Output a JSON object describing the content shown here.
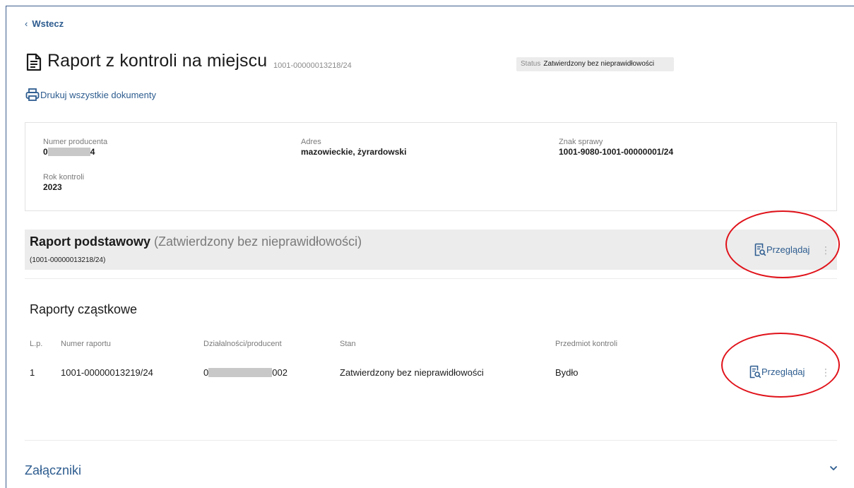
{
  "nav": {
    "back_label": "Wstecz"
  },
  "header": {
    "title": "Raport z kontroli na miejscu",
    "number": "1001-00000013218/24",
    "status_label": "Status",
    "status_value": "Zatwierdzony bez nieprawidłowości",
    "print_label": "Drukuj wszystkie dokumenty"
  },
  "info": {
    "producer_label": "Numer producenta",
    "producer_prefix": "0",
    "producer_suffix": "4",
    "address_label": "Adres",
    "address_value": "mazowieckie, żyrardowski",
    "case_label": "Znak sprawy",
    "case_value": "1001-9080-1001-00000001/24",
    "year_label": "Rok kontroli",
    "year_value": "2023"
  },
  "basic_report": {
    "title": "Raport podstawowy",
    "state": "(Zatwierdzony bez nieprawidłowości)",
    "number": "(1001-00000013218/24)",
    "view_label": "Przeglądaj"
  },
  "partial_reports": {
    "title": "Raporty cząstkowe",
    "columns": [
      "L.p.",
      "Numer raportu",
      "Działalności/producent",
      "Stan",
      "Przedmiot kontroli"
    ],
    "rows": [
      {
        "lp": "1",
        "number": "1001-00000013219/24",
        "producer_prefix": "0",
        "producer_suffix": "002",
        "state": "Zatwierdzony bez nieprawidłowości",
        "subject": "Bydło",
        "view_label": "Przeglądaj"
      }
    ]
  },
  "attachments": {
    "title": "Załączniki"
  },
  "colors": {
    "accent": "#2d5c8f",
    "annotation": "#e0121a",
    "bar": "#ececec"
  },
  "icons": [
    "chevron-left-icon",
    "document-icon",
    "printer-icon",
    "preview-icon",
    "kebab-icon",
    "chevron-down-icon"
  ]
}
